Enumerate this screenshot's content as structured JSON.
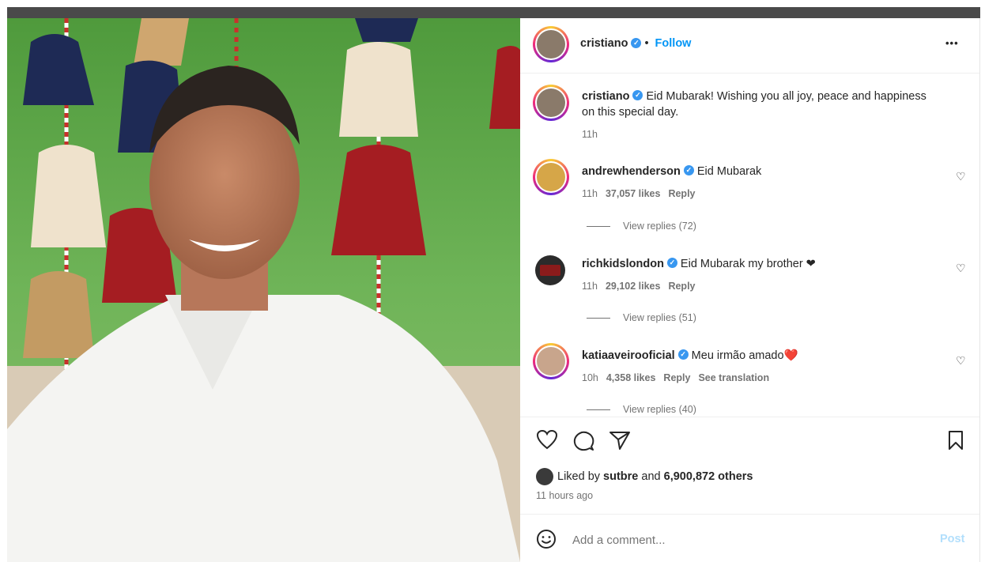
{
  "post": {
    "author": "cristiano",
    "separator": "•",
    "follow_label": "Follow",
    "more_label": "•••",
    "caption": {
      "username": "cristiano",
      "text": "Eid Mubarak! Wishing you all joy, peace and happiness on this special day.",
      "time": "11h"
    }
  },
  "comments": [
    {
      "username": "andrewhenderson",
      "text": "Eid Mubarak",
      "time": "11h",
      "likes": "37,057 likes",
      "reply": "Reply",
      "translation": "",
      "view_replies": "View replies (72)",
      "avatar_color": "#d6a648"
    },
    {
      "username": "richkidslondon",
      "text": "Eid Mubarak my brother ❤",
      "time": "11h",
      "likes": "29,102 likes",
      "reply": "Reply",
      "translation": "",
      "view_replies": "View replies (51)",
      "avatar_color": "#3a3a3a"
    },
    {
      "username": "katiaaveirooficial",
      "text": "Meu irmão amado❤️",
      "time": "10h",
      "likes": "4,358 likes",
      "reply": "Reply",
      "translation": "See translation",
      "view_replies": "View replies (40)",
      "avatar_color": "#c8a58c"
    }
  ],
  "actions": {
    "like_icon": "heart-icon",
    "comment_icon": "comment-icon",
    "share_icon": "share-icon",
    "save_icon": "bookmark-icon"
  },
  "likes": {
    "prefix": "Liked by",
    "user": "sutbre",
    "middle": "and",
    "others": "6,900,872 others"
  },
  "timestamp": "11 hours ago",
  "comment_box": {
    "emoji_icon": "smiley-icon",
    "placeholder": "Add a comment...",
    "post_label": "Post"
  },
  "colors": {
    "link": "#0095f6",
    "verified": "#3897f0",
    "muted": "#737373",
    "post_disabled": "#b2dffc"
  }
}
